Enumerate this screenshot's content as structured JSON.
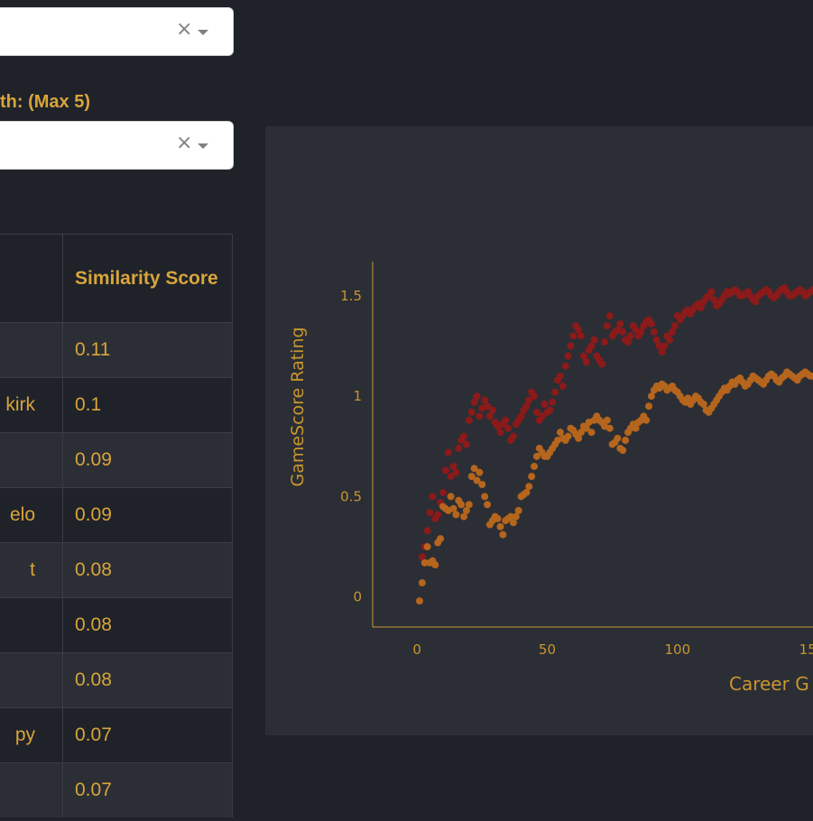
{
  "filters": {
    "select_one": {
      "value": "",
      "clear_symbol": "×"
    },
    "select_two_label": "th: (Max 5)",
    "select_two": {
      "value": "",
      "clear_symbol": "×"
    }
  },
  "table": {
    "header": {
      "col1": "",
      "col2": "Similarity Score"
    },
    "rows": [
      {
        "name": "",
        "score": "0.11"
      },
      {
        "name": "kirk",
        "score": "0.1"
      },
      {
        "name": "",
        "score": "0.09"
      },
      {
        "name": "elo",
        "score": "0.09"
      },
      {
        "name": "t",
        "score": "0.08"
      },
      {
        "name": "",
        "score": "0.08"
      },
      {
        "name": "",
        "score": "0.08"
      },
      {
        "name": "py",
        "score": "0.07"
      },
      {
        "name": "",
        "score": "0.07"
      }
    ]
  },
  "chart_data": {
    "type": "scatter",
    "ylabel": "GameScore Rating",
    "xlabel": "Career G",
    "x_ticks": [
      "0",
      "50",
      "100",
      "15"
    ],
    "y_ticks": [
      "0",
      "0.5",
      "1",
      "1.5"
    ],
    "xlim": [
      -17,
      152
    ],
    "ylim": [
      -0.15,
      1.67
    ],
    "colors": {
      "series_red": "#8b1a1a",
      "series_orange": "#b5651d",
      "axis": "#c9962f",
      "background": "#2b2e35"
    },
    "series": [
      {
        "color": "#8b1a1a",
        "x": [
          1,
          2,
          3,
          4,
          5,
          6,
          7,
          8,
          9,
          10,
          11,
          12,
          13,
          14,
          15,
          16,
          17,
          18,
          19,
          20,
          21,
          22,
          23,
          24,
          25,
          26,
          27,
          28,
          29,
          30,
          31,
          32,
          33,
          34,
          35,
          36,
          37,
          38,
          39,
          40,
          41,
          42,
          43,
          44,
          45,
          46,
          47,
          48,
          49,
          50,
          51,
          52,
          53,
          54,
          55,
          56,
          57,
          58,
          59,
          60,
          61,
          62,
          63,
          64,
          65,
          66,
          67,
          68,
          69,
          70,
          71,
          72,
          73,
          74,
          75,
          76,
          77,
          78,
          79,
          80,
          81,
          82,
          83,
          84,
          85,
          86,
          87,
          88,
          89,
          90,
          91,
          92,
          93,
          94,
          95,
          96,
          97,
          98,
          99,
          100,
          101,
          102,
          103,
          104,
          105,
          106,
          107,
          108,
          109,
          110,
          111,
          112,
          113,
          114,
          115,
          116,
          117,
          118,
          119,
          120,
          121,
          122,
          123,
          124,
          125,
          126,
          127,
          128,
          129,
          130,
          131,
          132,
          133,
          134,
          135,
          136,
          137,
          138,
          139,
          140,
          141,
          142,
          143,
          144,
          145,
          146,
          147,
          148,
          149,
          150,
          151,
          152
        ],
        "y": [
          -0.02,
          0.2,
          0.25,
          0.33,
          0.42,
          0.5,
          0.39,
          0.41,
          0.47,
          0.52,
          0.63,
          0.72,
          0.6,
          0.65,
          0.62,
          0.74,
          0.78,
          0.8,
          0.76,
          0.88,
          0.92,
          0.97,
          1.0,
          0.9,
          0.94,
          0.98,
          0.95,
          0.9,
          0.93,
          0.87,
          0.85,
          0.82,
          0.86,
          0.88,
          0.84,
          0.78,
          0.8,
          0.86,
          0.88,
          0.9,
          0.93,
          0.95,
          0.98,
          1.02,
          1.0,
          0.92,
          0.88,
          0.9,
          0.96,
          0.92,
          0.93,
          0.97,
          1.02,
          1.08,
          1.1,
          1.05,
          1.15,
          1.2,
          1.25,
          1.3,
          1.35,
          1.33,
          1.3,
          1.2,
          1.17,
          1.23,
          1.25,
          1.28,
          1.2,
          1.18,
          1.16,
          1.27,
          1.35,
          1.4,
          1.3,
          1.32,
          1.33,
          1.36,
          1.32,
          1.28,
          1.27,
          1.3,
          1.35,
          1.33,
          1.3,
          1.32,
          1.35,
          1.37,
          1.38,
          1.36,
          1.32,
          1.28,
          1.25,
          1.22,
          1.25,
          1.3,
          1.28,
          1.32,
          1.35,
          1.4,
          1.38,
          1.4,
          1.42,
          1.43,
          1.41,
          1.43,
          1.45,
          1.46,
          1.44,
          1.47,
          1.49,
          1.5,
          1.52,
          1.48,
          1.45,
          1.46,
          1.48,
          1.5,
          1.52,
          1.51,
          1.52,
          1.53,
          1.52,
          1.5,
          1.5,
          1.51,
          1.52,
          1.5,
          1.48,
          1.47,
          1.5,
          1.51,
          1.52,
          1.53,
          1.52,
          1.5,
          1.49,
          1.5,
          1.52,
          1.53,
          1.54,
          1.52,
          1.5,
          1.5,
          1.51,
          1.52,
          1.53,
          1.52,
          1.5,
          1.51,
          1.52,
          1.53
        ]
      },
      {
        "color": "#b5651d",
        "x": [
          1,
          2,
          3,
          4,
          5,
          6,
          7,
          8,
          9,
          10,
          11,
          12,
          13,
          14,
          15,
          16,
          17,
          18,
          19,
          20,
          21,
          22,
          23,
          24,
          25,
          26,
          27,
          28,
          29,
          30,
          31,
          32,
          33,
          34,
          35,
          36,
          37,
          38,
          39,
          40,
          41,
          42,
          43,
          44,
          45,
          46,
          47,
          48,
          49,
          50,
          51,
          52,
          53,
          54,
          55,
          56,
          57,
          58,
          59,
          60,
          61,
          62,
          63,
          64,
          65,
          66,
          67,
          68,
          69,
          70,
          71,
          72,
          73,
          74,
          75,
          76,
          77,
          78,
          79,
          80,
          81,
          82,
          83,
          84,
          85,
          86,
          87,
          88,
          89,
          90,
          91,
          92,
          93,
          94,
          95,
          96,
          97,
          98,
          99,
          100,
          101,
          102,
          103,
          104,
          105,
          106,
          107,
          108,
          109,
          110,
          111,
          112,
          113,
          114,
          115,
          116,
          117,
          118,
          119,
          120,
          121,
          122,
          123,
          124,
          125,
          126,
          127,
          128,
          129,
          130,
          131,
          132,
          133,
          134,
          135,
          136,
          137,
          138,
          139,
          140,
          141,
          142,
          143,
          144,
          145,
          146,
          147,
          148,
          149,
          150,
          151,
          152
        ],
        "y": [
          -0.02,
          0.07,
          0.17,
          0.25,
          0.17,
          0.18,
          0.16,
          0.27,
          0.29,
          0.45,
          0.44,
          0.43,
          0.5,
          0.44,
          0.41,
          0.48,
          0.46,
          0.4,
          0.43,
          0.46,
          0.6,
          0.64,
          0.58,
          0.62,
          0.56,
          0.5,
          0.46,
          0.36,
          0.38,
          0.4,
          0.39,
          0.35,
          0.31,
          0.38,
          0.39,
          0.4,
          0.37,
          0.4,
          0.43,
          0.5,
          0.51,
          0.52,
          0.55,
          0.6,
          0.65,
          0.7,
          0.74,
          0.72,
          0.7,
          0.7,
          0.72,
          0.74,
          0.76,
          0.78,
          0.82,
          0.79,
          0.78,
          0.8,
          0.84,
          0.83,
          0.81,
          0.79,
          0.82,
          0.85,
          0.84,
          0.87,
          0.82,
          0.88,
          0.9,
          0.88,
          0.87,
          0.85,
          0.88,
          0.84,
          0.76,
          0.77,
          0.79,
          0.74,
          0.73,
          0.78,
          0.82,
          0.84,
          0.86,
          0.84,
          0.87,
          0.88,
          0.9,
          0.88,
          0.95,
          1.0,
          1.03,
          1.05,
          1.04,
          1.06,
          1.05,
          1.03,
          1.04,
          1.05,
          1.03,
          1.02,
          1.0,
          0.98,
          0.97,
          0.99,
          0.96,
          0.98,
          1.0,
          0.99,
          0.97,
          0.96,
          0.93,
          0.92,
          0.94,
          0.96,
          0.98,
          1.0,
          1.02,
          1.04,
          1.03,
          1.05,
          1.07,
          1.06,
          1.08,
          1.09,
          1.07,
          1.05,
          1.06,
          1.08,
          1.1,
          1.09,
          1.08,
          1.07,
          1.06,
          1.08,
          1.1,
          1.11,
          1.1,
          1.08,
          1.07,
          1.09,
          1.1,
          1.12,
          1.11,
          1.1,
          1.09,
          1.08,
          1.1,
          1.11,
          1.12,
          1.11,
          1.1,
          1.1
        ]
      }
    ]
  }
}
